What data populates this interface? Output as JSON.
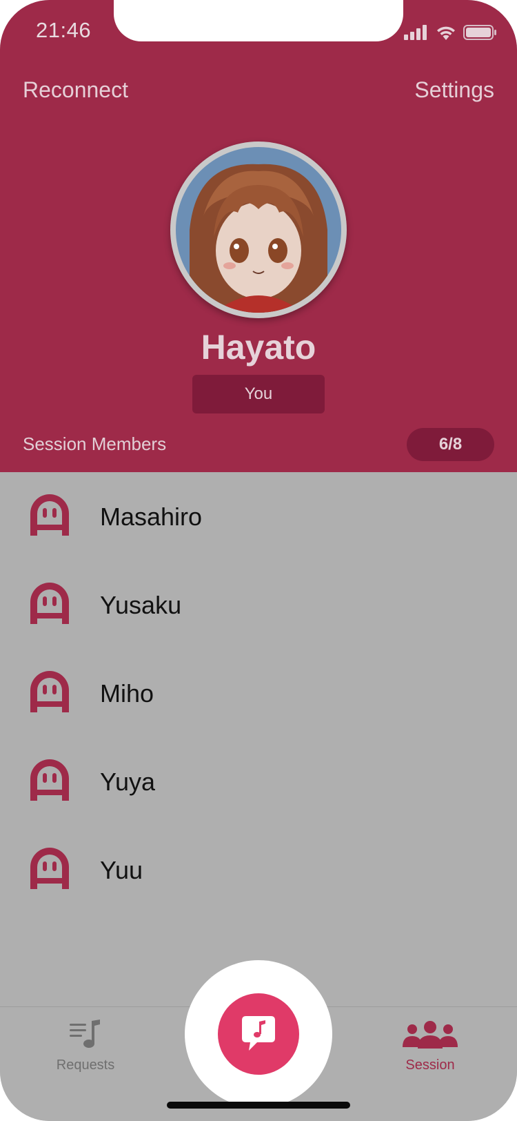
{
  "status_bar": {
    "time": "21:46",
    "icons": [
      "signal-icon",
      "wifi-icon",
      "battery-icon"
    ]
  },
  "nav": {
    "left_label": "Reconnect",
    "right_label": "Settings"
  },
  "profile": {
    "name": "Hayato",
    "badge": "You"
  },
  "session": {
    "section_label": "Session Members",
    "count": "6/8"
  },
  "members": [
    {
      "name": "Masahiro"
    },
    {
      "name": "Yusaku"
    },
    {
      "name": "Miho"
    },
    {
      "name": "Yuya"
    },
    {
      "name": "Yuu"
    }
  ],
  "tabbar": {
    "tabs": [
      {
        "label": "Requests",
        "icon": "music-list-icon",
        "active": false
      },
      {
        "label": "Session",
        "icon": "group-icon",
        "active": true
      }
    ],
    "center_action_icon": "music-note-chat-icon"
  },
  "colors": {
    "accent": "#9e2a49",
    "badge_bg": "#7f1b3a",
    "fab": "#e03a68",
    "list_bg": "#afafaf"
  }
}
